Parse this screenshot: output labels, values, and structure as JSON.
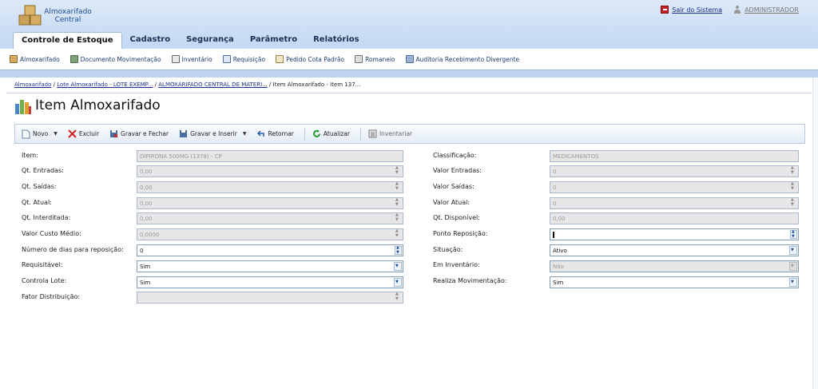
{
  "app": {
    "title_line1": "Almoxarifado",
    "title_line2": "Central"
  },
  "header_links": {
    "logout": "Sair do Sistema",
    "user": "ADMINISTRADOR"
  },
  "main_tabs": [
    "Controle de Estoque",
    "Cadastro",
    "Segurança",
    "Parâmetro",
    "Relatórios"
  ],
  "subnav": [
    "Almoxarifado",
    "Documento Movimentação",
    "Inventário",
    "Requisição",
    "Pedido Cota Padrão",
    "Romaneio",
    "Auditoria Recebimento Divergente"
  ],
  "breadcrumb": {
    "crumb1": "Almoxarifado",
    "crumb2": "Lote Almoxarifado - LOTE EXEMP...",
    "crumb3": "ALMOXARIFADO CENTRAL DE MATERI...",
    "current": "Item Almoxarifado - Item 137...",
    "separator": "/"
  },
  "page_title": "Item Almoxarifado",
  "toolbar": {
    "novo": "Novo",
    "excluir": "Excluir",
    "gravar_fechar": "Gravar e Fechar",
    "gravar_inserir": "Gravar e Inserir",
    "retornar": "Retornar",
    "atualizar": "Atualizar",
    "inventariar": "Inventariar"
  },
  "form": {
    "item": {
      "label": "Item:",
      "value": "DIPIRONA 500MG (1378) - CP"
    },
    "qt_entradas": {
      "label": "Qt. Entradas:",
      "value": "0,00"
    },
    "qt_saidas": {
      "label": "Qt. Saídas:",
      "value": "0,00"
    },
    "qt_atual": {
      "label": "Qt. Atual:",
      "value": "0,00"
    },
    "qt_interditada": {
      "label": "Qt. Interditada:",
      "value": "0,00"
    },
    "valor_custo_medio": {
      "label": "Valor Custo Médio:",
      "value": "0,0000"
    },
    "num_dias_reposicao": {
      "label": "Número de dias para reposição:",
      "value": "0"
    },
    "requisitavel": {
      "label": "Requisitável:",
      "value": "Sim"
    },
    "controla_lote": {
      "label": "Controla Lote:",
      "value": "Sim"
    },
    "fator_distribuicao": {
      "label": "Fator Distribuição:",
      "value": ""
    },
    "classificacao": {
      "label": "Classificação:",
      "value": "MEDICAMENTOS"
    },
    "valor_entradas": {
      "label": "Valor Entradas:",
      "value": "0"
    },
    "valor_saidas": {
      "label": "Valor Saídas:",
      "value": "0"
    },
    "valor_atual": {
      "label": "Valor Atual:",
      "value": "0"
    },
    "qt_disponivel": {
      "label": "Qt. Disponível:",
      "value": "0,00"
    },
    "ponto_reposicao": {
      "label": "Ponto Reposição:",
      "value": ""
    },
    "situacao": {
      "label": "Situação:",
      "value": "Ativo"
    },
    "em_inventario": {
      "label": "Em Inventário:",
      "value": "Não"
    },
    "realiza_movimentacao": {
      "label": "Realiza Movimentação:",
      "value": "Sim"
    }
  },
  "icons": {
    "logo": "boxes-logo-icon",
    "logout": "exit-icon",
    "user": "user-icon"
  }
}
